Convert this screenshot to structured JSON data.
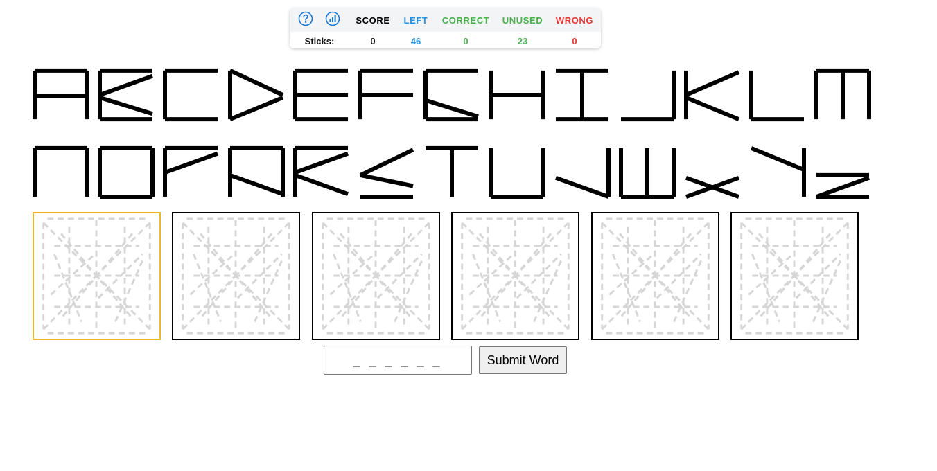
{
  "stats": {
    "row_label": "Sticks:",
    "columns": [
      {
        "key": "score",
        "label": "SCORE",
        "value": "0",
        "color": "#111111"
      },
      {
        "key": "left",
        "label": "LEFT",
        "value": "46",
        "color": "#2f8fd8"
      },
      {
        "key": "correct",
        "label": "CORRECT",
        "value": "0",
        "color": "#4caf50"
      },
      {
        "key": "unused",
        "label": "UNUSED",
        "value": "23",
        "color": "#4caf50"
      },
      {
        "key": "wrong",
        "label": "WRONG",
        "value": "0",
        "color": "#e53935"
      }
    ],
    "icons": [
      "help-icon",
      "stats-icon"
    ],
    "icon_color": "#1976d2"
  },
  "alphabet": {
    "row1": [
      "A",
      "B",
      "C",
      "D",
      "E",
      "F",
      "G",
      "H",
      "I",
      "J",
      "K",
      "L",
      "M"
    ],
    "row2": [
      "N",
      "O",
      "P",
      "Q",
      "R",
      "S",
      "T",
      "U",
      "V",
      "W",
      "X",
      "Y",
      "Z"
    ]
  },
  "tiles": {
    "count": 6,
    "active_index": 0,
    "active_color": "#f0b429"
  },
  "word": {
    "placeholder": "_ _ _ _ _ _",
    "submit_label": "Submit Word"
  }
}
